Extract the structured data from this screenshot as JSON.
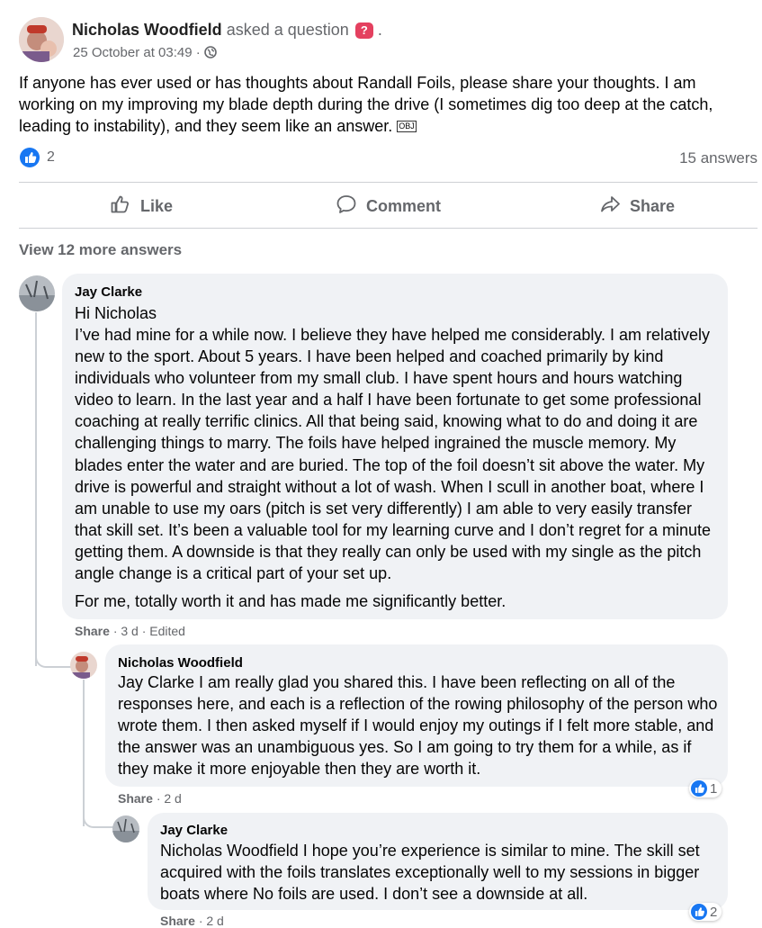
{
  "post": {
    "author": "Nicholas Woodfield",
    "action": "asked a question",
    "period": ".",
    "question_badge": "?",
    "timestamp": "25 October at 03:49",
    "sep": "·",
    "text": "If anyone has ever used or has thoughts about Randall Foils, please share your thoughts. I am working on my improving my blade depth during the drive (I sometimes dig too deep at the catch, leading to instability), and they seem like an answer.",
    "obj_glyph": "OBJ",
    "like_count": "2",
    "answers": "15 answers"
  },
  "actions": {
    "like": "Like",
    "comment": "Comment",
    "share": "Share"
  },
  "view_more": "View 12 more answers",
  "comments": [
    {
      "name": "Jay Clarke",
      "greeting": "Hi Nicholas",
      "text": "I’ve had mine for a while now. I believe they have helped me considerably. I am relatively new to the sport. About 5 years. I have been helped and coached primarily by kind individuals who volunteer from my small club. I have spent hours and hours watching video to learn. In the last year and a half I have been fortunate to get some professional coaching at really terrific clinics. All that being said, knowing what to do and doing it are challenging things to marry. The foils have helped ingrained the muscle memory. My blades enter the water and are buried. The top of the foil doesn’t sit above the water. My drive is powerful and straight without a lot of wash. When I scull in another boat, where I am unable to use my oars (pitch is set very differently) I am able to very easily transfer that skill set. It’s been a valuable tool for my learning curve and I don’t regret for a minute getting them. A downside is that they really can only be used with my single as the pitch angle change is a critical part of your set up.",
      "text2": "For me, totally worth it and has made me significantly better.",
      "share": "Share",
      "meta": "· 3 d · Edited"
    },
    {
      "name": "Nicholas Woodfield",
      "text": "Jay Clarke I am really glad you shared this. I have been reflecting on all of the responses here, and each is a reflection of the rowing philosophy of the person who wrote them. I then asked myself if I would enjoy my outings if I felt more stable, and the answer was an unambiguous yes. So I am going to try them for a while, as if they make it more enjoyable then they are worth it.",
      "share": "Share",
      "meta": "· 2 d",
      "reactions": "1"
    },
    {
      "name": "Jay Clarke",
      "text": "Nicholas Woodfield I hope you’re experience is similar to mine. The skill set acquired with the foils translates exceptionally well to my sessions in bigger boats where No foils are used. I don’t see a downside at all.",
      "share": "Share",
      "meta": "· 2 d",
      "reactions": "2"
    }
  ],
  "colors": {
    "accent": "#1877f2",
    "bubble": "#f0f2f5",
    "muted": "#65676b",
    "badge": "#e4405f"
  }
}
